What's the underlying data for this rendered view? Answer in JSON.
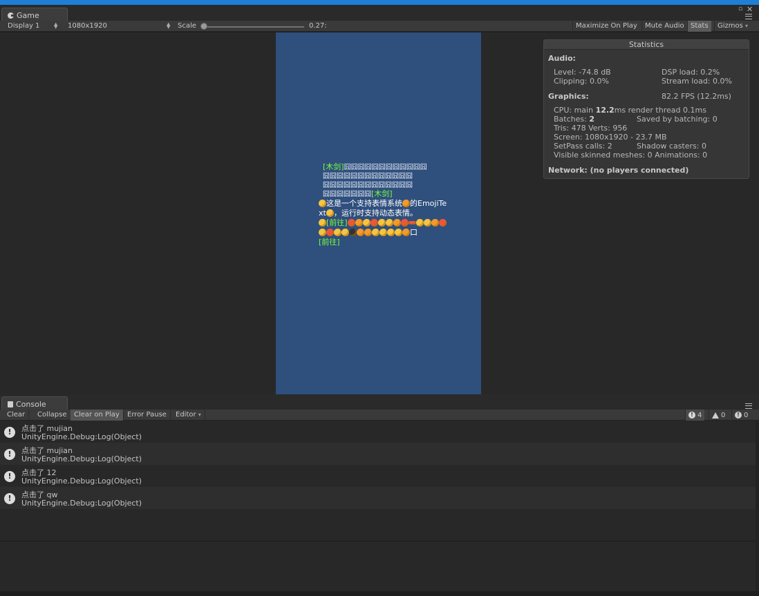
{
  "game_window": {
    "tab_title": "Game",
    "toolbar": {
      "display": "Display 1",
      "resolution": "1080x1920",
      "scale_label": "Scale",
      "scale_value": "0.27:",
      "maximize_on_play": "Maximize On Play",
      "mute_audio": "Mute Audio",
      "stats": "Stats",
      "gizmos": "Gizmos"
    },
    "scene": {
      "line1_link": "[木剑]",
      "line1_boxes": "囧囧囧囧囧囧囧囧囧囧囧囧",
      "line2_boxes": "囧囧囧囧囧囧囧囧囧囧囧囧囧",
      "line3_boxes": "囧囧囧囧囧囧囧囧囧囧囧囧囧",
      "line4_boxes": "囧囧囧囧囧囧囧",
      "line4_link": "[木剑]",
      "line5_a": "这是一个支持表情系统",
      "line5_b": "的EmojiTe",
      "line6_a": "xt",
      "line6_b": "，运行时支持动态表情。",
      "line7_link": "[前往]",
      "line8_tail": "口",
      "line9_link": "[前往]"
    }
  },
  "statistics": {
    "title": "Statistics",
    "audio_header": "Audio:",
    "level": "Level: -74.8 dB",
    "clipping": "Clipping: 0.0%",
    "dsp_load": "DSP load: 0.2%",
    "stream_load": "Stream load: 0.0%",
    "graphics_header": "Graphics:",
    "fps": "82.2 FPS (12.2ms)",
    "cpu_prefix": "CPU: main ",
    "cpu_main": "12.2",
    "cpu_suffix": "ms  render thread 0.1ms",
    "batches_prefix": "Batches: ",
    "batches": "2",
    "saved_by_batching": "Saved by batching: 0",
    "tris": "Tris: 478  Verts: 956",
    "screen": "Screen: 1080x1920 - 23.7 MB",
    "setpass": "SetPass calls: 2",
    "shadow_casters": "Shadow casters: 0",
    "skinned": "Visible skinned meshes: 0  Animations: 0",
    "network": "Network: (no players connected)"
  },
  "console": {
    "tab_title": "Console",
    "toolbar": {
      "clear": "Clear",
      "collapse": "Collapse",
      "clear_on_play": "Clear on Play",
      "error_pause": "Error Pause",
      "editor": "Editor",
      "log_count": "4",
      "warn_count": "0",
      "error_count": "0"
    },
    "entries": [
      {
        "message": "点击了 mujian",
        "source": "UnityEngine.Debug:Log(Object)"
      },
      {
        "message": "点击了 mujian",
        "source": "UnityEngine.Debug:Log(Object)"
      },
      {
        "message": "点击了 12",
        "source": "UnityEngine.Debug:Log(Object)"
      },
      {
        "message": "点击了 qw",
        "source": "UnityEngine.Debug:Log(Object)"
      }
    ]
  },
  "colors": {
    "accent_top": "#1e7fd6",
    "game_background": "#2f4f7d",
    "link_green": "#7dff3a"
  }
}
